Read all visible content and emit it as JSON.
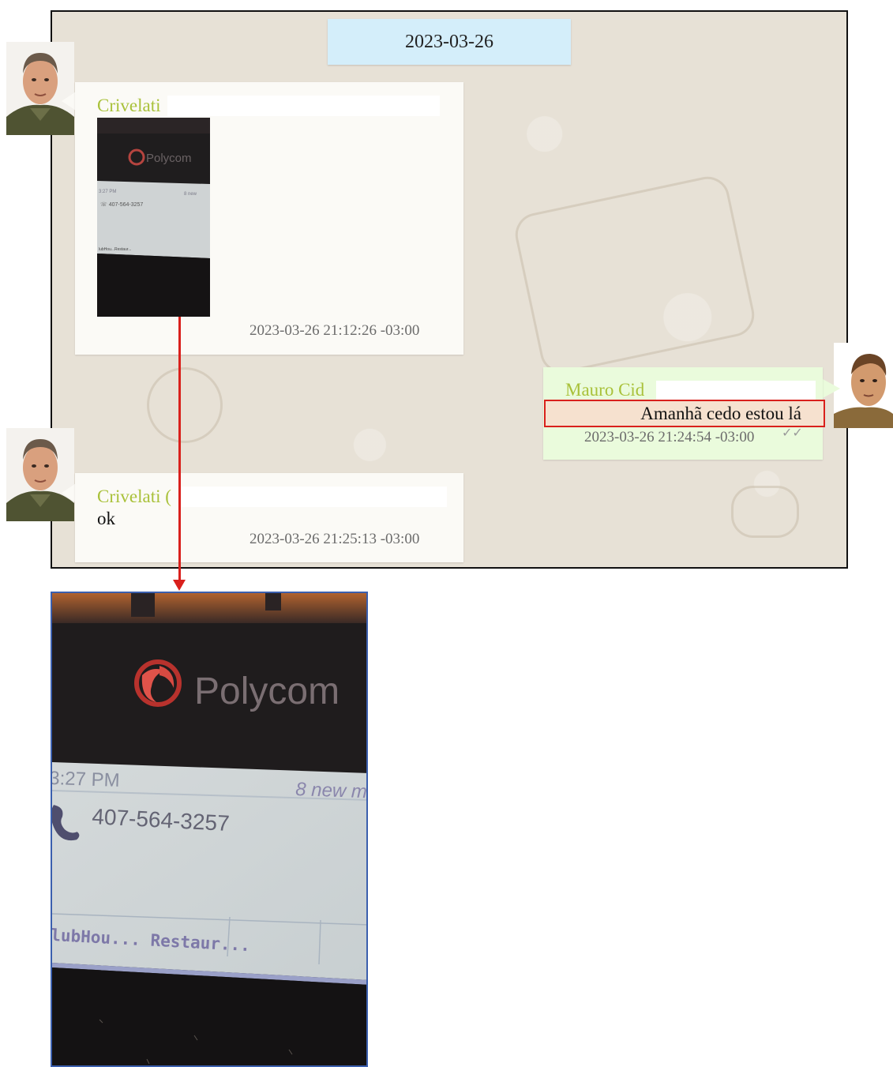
{
  "chat": {
    "date_chip": "2023-03-26",
    "messages": [
      {
        "sender": "Crivelati",
        "timestamp": "2023-03-26 21:12:26 -03:00",
        "type": "image"
      },
      {
        "sender": "Mauro Cid",
        "text": "Amanhã cedo estou lá",
        "timestamp": "2023-03-26 21:24:54 -03:00",
        "status_icon": "double-check-icon"
      },
      {
        "sender": "Crivelati (",
        "text": "ok",
        "timestamp": "2023-03-26 21:25:13 -03:00"
      }
    ]
  },
  "photo": {
    "brand": "Polycom",
    "time": "3:27 PM",
    "notice": "8 new m",
    "phone_number": "407-564-3257",
    "softkeys": "lubHou... Restaur..."
  },
  "colors": {
    "sender_name": "#a9c13a",
    "highlight_border": "#d9201c",
    "arrow": "#d9201c",
    "date_chip": "#d4eefa",
    "outgoing_bubble": "#eafbdc"
  }
}
